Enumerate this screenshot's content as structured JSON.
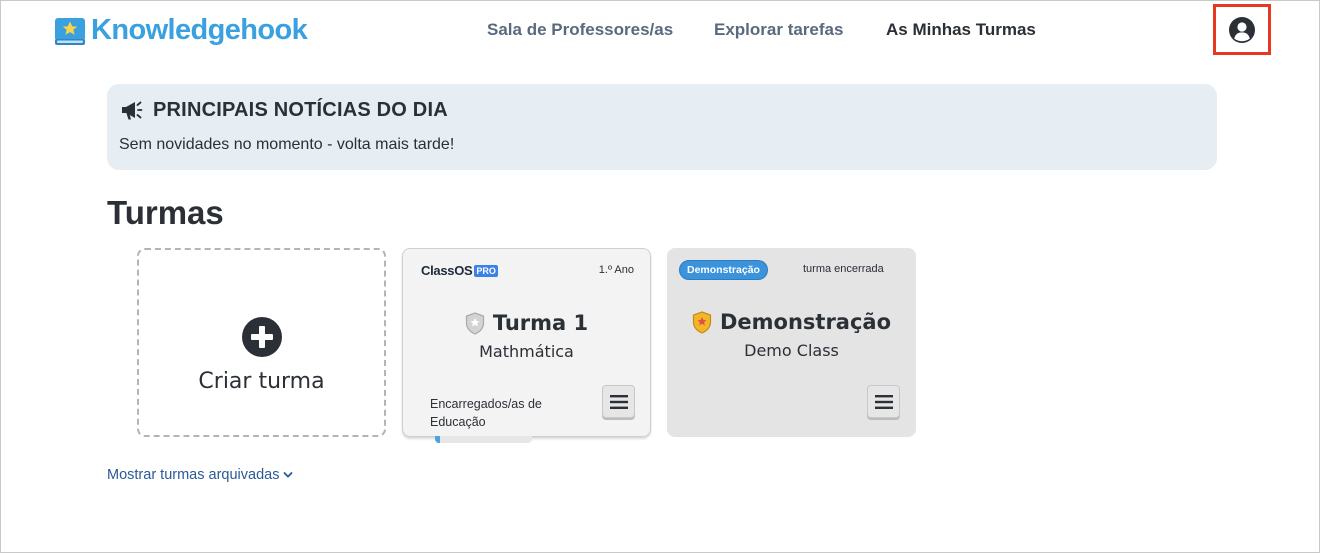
{
  "header": {
    "logo_text": "Knowledgehook",
    "nav": [
      {
        "label": "Sala de Professores/as",
        "active": false
      },
      {
        "label": "Explorar tarefas",
        "active": false
      },
      {
        "label": "As Minhas Turmas",
        "active": true
      }
    ],
    "profile_icon": "user-circle-icon"
  },
  "news": {
    "icon": "megaphone-icon",
    "title": "PRINCIPAIS NOTÍCIAS DO DIA",
    "body": "Sem novidades no momento - volta mais tarde!"
  },
  "classes": {
    "section_title": "Turmas",
    "create_card": {
      "icon": "plus-circle-icon",
      "label": "Criar turma"
    },
    "class_card": {
      "brand": "ClassOS",
      "brand_badge": "PRO",
      "year": "1.º Ano",
      "shield_icon": "shield-icon",
      "title": "Turma 1",
      "subtitle": "Mathmática",
      "parents_label": "Encarregados/as de Educação",
      "menu_icon": "hamburger-menu-icon"
    },
    "demo_card": {
      "badge": "Demonstração",
      "status": "turma encerrada",
      "shield_icon": "gold-shield-icon",
      "title": "Demonstração",
      "subtitle": "Demo Class",
      "menu_icon": "hamburger-menu-icon"
    },
    "archived_link": "Mostrar turmas arquivadas",
    "archived_icon": "chevron-down-icon"
  },
  "colors": {
    "brand": "#3aa0e0",
    "highlight": "#e53920",
    "news_bg": "#e7eef3",
    "demo_badge": "#3b93dc"
  }
}
